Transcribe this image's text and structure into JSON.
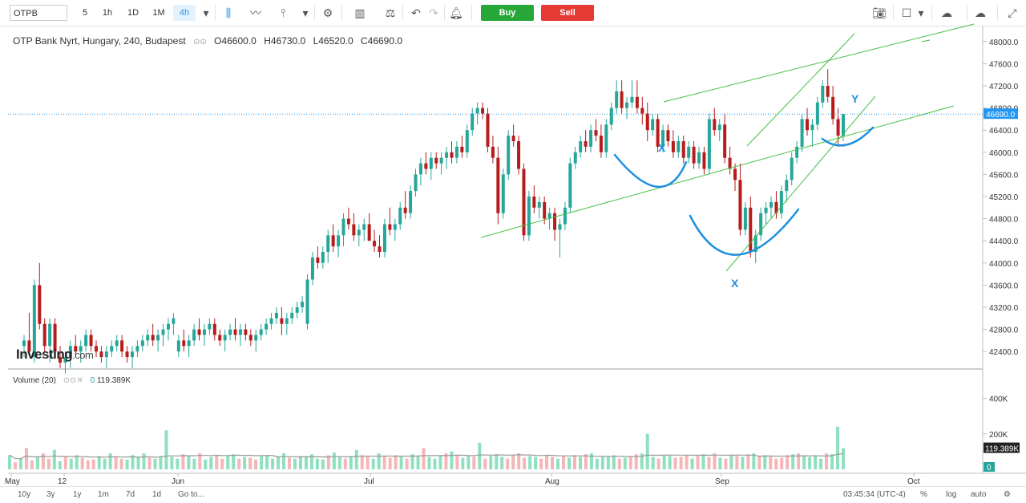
{
  "toolbar": {
    "symbol": "OTPB",
    "intervals": [
      "5",
      "1h",
      "1D",
      "1M",
      "4h"
    ],
    "active_interval": "4h",
    "buy_label": "Buy",
    "sell_label": "Sell"
  },
  "legend": {
    "title": "OTP Bank Nyrt, Hungary, 240, Budapest",
    "open": "O46600.0",
    "high": "H46730.0",
    "low": "L46520.0",
    "close": "C46690.0"
  },
  "volume_legend": {
    "label": "Volume (20)",
    "value_prefix": "0",
    "value": "119.389K"
  },
  "logo": {
    "main": "Investing",
    "suffix": ".com"
  },
  "bottom": {
    "ranges": [
      "10y",
      "3y",
      "1y",
      "1m",
      "7d",
      "1d"
    ],
    "goto": "Go to...",
    "clock": "03:45:34 (UTC-4)",
    "percent": "%",
    "log": "log",
    "auto": "auto"
  },
  "colors": {
    "up": "#26a69a",
    "down": "#b71c1c",
    "vol_up": "#8fe0c0",
    "vol_down": "#f4b6b6",
    "trend": "#43c043",
    "pattern": "#1e90e0",
    "last_price": "#2196f3"
  },
  "chart_data": {
    "type": "candlestick",
    "title": "OTP Bank Nyrt, Hungary, 240, Budapest",
    "price_axis": {
      "ylim": [
        42200,
        48200
      ],
      "ticks": [
        42400,
        42800,
        43200,
        43600,
        44000,
        44400,
        44800,
        45200,
        45600,
        46000,
        46400,
        46800,
        47200,
        47600,
        48000
      ]
    },
    "volume_axis": {
      "ylim": [
        0,
        520000
      ],
      "ticks": [
        "400K",
        "200K"
      ]
    },
    "x_labels": [
      "May",
      "12",
      "Jun",
      "Jul",
      "Aug",
      "Sep",
      "Oct"
    ],
    "last_price": 46690.0,
    "last_volume": "119.389K",
    "candles_ohlc": [
      [
        42500,
        42700,
        42300,
        42600
      ],
      [
        42600,
        43100,
        42400,
        42400
      ],
      [
        42300,
        43700,
        42200,
        43600
      ],
      [
        43600,
        44000,
        42800,
        42900
      ],
      [
        42900,
        43000,
        42400,
        42500
      ],
      [
        42500,
        43000,
        42200,
        42900
      ],
      [
        42900,
        43000,
        42300,
        42400
      ],
      [
        42300,
        42500,
        42100,
        42200
      ],
      [
        42200,
        42400,
        42000,
        42300
      ],
      [
        42300,
        42600,
        42100,
        42500
      ],
      [
        42500,
        42700,
        42300,
        42400
      ],
      [
        42400,
        42600,
        42200,
        42500
      ],
      [
        42500,
        42800,
        42400,
        42700
      ],
      [
        42700,
        42800,
        42400,
        42500
      ],
      [
        42500,
        42600,
        42300,
        42400
      ],
      [
        42400,
        42500,
        42200,
        42300
      ],
      [
        42300,
        42500,
        42100,
        42400
      ],
      [
        42400,
        42600,
        42300,
        42500
      ],
      [
        42500,
        42700,
        42400,
        42600
      ],
      [
        42600,
        42700,
        42300,
        42400
      ],
      [
        42400,
        42500,
        42200,
        42300
      ],
      [
        42300,
        42500,
        42100,
        42400
      ],
      [
        42400,
        42600,
        42300,
        42500
      ],
      [
        42500,
        42700,
        42400,
        42600
      ],
      [
        42600,
        42800,
        42500,
        42700
      ],
      [
        42700,
        42900,
        42500,
        42600
      ],
      [
        42600,
        42800,
        42400,
        42700
      ],
      [
        42700,
        42900,
        42500,
        42800
      ],
      [
        42800,
        43000,
        42600,
        42900
      ],
      [
        42900,
        43100,
        42700,
        43000
      ],
      [
        42400,
        42700,
        42300,
        42600
      ],
      [
        42600,
        42800,
        42400,
        42500
      ],
      [
        42500,
        42700,
        42300,
        42600
      ],
      [
        42600,
        42900,
        42500,
        42800
      ],
      [
        42800,
        43000,
        42600,
        42700
      ],
      [
        42700,
        42900,
        42500,
        42800
      ],
      [
        42800,
        43000,
        42700,
        42900
      ],
      [
        42900,
        43000,
        42600,
        42700
      ],
      [
        42700,
        42800,
        42500,
        42600
      ],
      [
        42600,
        42800,
        42400,
        42700
      ],
      [
        42700,
        42900,
        42600,
        42800
      ],
      [
        42800,
        43000,
        42600,
        42700
      ],
      [
        42700,
        42900,
        42500,
        42800
      ],
      [
        42800,
        42900,
        42600,
        42700
      ],
      [
        42700,
        42800,
        42500,
        42600
      ],
      [
        42600,
        42800,
        42400,
        42700
      ],
      [
        42700,
        42900,
        42600,
        42800
      ],
      [
        42800,
        43000,
        42700,
        42900
      ],
      [
        42900,
        43100,
        42800,
        43000
      ],
      [
        43000,
        43200,
        42900,
        43100
      ],
      [
        43000,
        43200,
        42700,
        42900
      ],
      [
        42900,
        43100,
        42700,
        43000
      ],
      [
        43000,
        43200,
        42900,
        43100
      ],
      [
        43100,
        43300,
        43000,
        43200
      ],
      [
        43200,
        43400,
        43100,
        43300
      ],
      [
        42900,
        43800,
        42800,
        43700
      ],
      [
        43700,
        44200,
        43600,
        44100
      ],
      [
        44100,
        44300,
        43900,
        44000
      ],
      [
        44000,
        44300,
        43900,
        44200
      ],
      [
        44200,
        44600,
        44000,
        44500
      ],
      [
        44500,
        44700,
        44200,
        44300
      ],
      [
        44300,
        44600,
        44100,
        44500
      ],
      [
        44500,
        44900,
        44300,
        44800
      ],
      [
        44800,
        45000,
        44600,
        44700
      ],
      [
        44700,
        44900,
        44400,
        44500
      ],
      [
        44500,
        44700,
        44300,
        44600
      ],
      [
        44600,
        44800,
        44400,
        44700
      ],
      [
        44700,
        44900,
        44500,
        44400
      ],
      [
        44400,
        44600,
        44200,
        44300
      ],
      [
        44300,
        44500,
        44100,
        44200
      ],
      [
        44200,
        44800,
        44100,
        44700
      ],
      [
        44700,
        45000,
        44500,
        44600
      ],
      [
        44600,
        44800,
        44400,
        44700
      ],
      [
        44700,
        45100,
        44600,
        45000
      ],
      [
        45000,
        45300,
        44800,
        44900
      ],
      [
        44900,
        45400,
        44800,
        45300
      ],
      [
        45300,
        45700,
        45200,
        45600
      ],
      [
        45600,
        45900,
        45400,
        45800
      ],
      [
        45800,
        46000,
        45600,
        45700
      ],
      [
        45700,
        46000,
        45500,
        45900
      ],
      [
        45900,
        46000,
        45700,
        45800
      ],
      [
        45800,
        46000,
        45600,
        45900
      ],
      [
        45900,
        46100,
        45700,
        46000
      ],
      [
        46000,
        46200,
        45800,
        45900
      ],
      [
        45900,
        46200,
        45800,
        46100
      ],
      [
        46100,
        46300,
        45900,
        46000
      ],
      [
        46000,
        46500,
        45900,
        46400
      ],
      [
        46400,
        46800,
        46300,
        46700
      ],
      [
        46700,
        46900,
        46500,
        46800
      ],
      [
        46800,
        46900,
        46600,
        46700
      ],
      [
        46700,
        46800,
        46000,
        46100
      ],
      [
        46100,
        46300,
        45800,
        45900
      ],
      [
        45900,
        46100,
        44700,
        44900
      ],
      [
        44900,
        45700,
        44800,
        45600
      ],
      [
        45600,
        46400,
        45500,
        46300
      ],
      [
        46300,
        46500,
        46100,
        46200
      ],
      [
        46200,
        46300,
        45600,
        45700
      ],
      [
        45700,
        45800,
        44400,
        44500
      ],
      [
        44500,
        45300,
        44400,
        45200
      ],
      [
        45200,
        45400,
        44900,
        45000
      ],
      [
        45000,
        45200,
        44800,
        45100
      ],
      [
        45100,
        45200,
        44700,
        44800
      ],
      [
        44800,
        45000,
        44600,
        44900
      ],
      [
        44900,
        45000,
        44400,
        44600
      ],
      [
        44600,
        44800,
        44100,
        44700
      ],
      [
        44700,
        45100,
        44600,
        45000
      ],
      [
        45000,
        45900,
        44900,
        45800
      ],
      [
        45800,
        46100,
        45700,
        46000
      ],
      [
        46000,
        46300,
        45900,
        46200
      ],
      [
        46200,
        46400,
        46000,
        46100
      ],
      [
        46100,
        46500,
        46000,
        46400
      ],
      [
        46400,
        46600,
        46200,
        46300
      ],
      [
        46300,
        46500,
        45900,
        46000
      ],
      [
        46000,
        46600,
        45900,
        46500
      ],
      [
        46500,
        46900,
        46400,
        46800
      ],
      [
        46800,
        47300,
        46700,
        47100
      ],
      [
        47100,
        47300,
        46700,
        46800
      ],
      [
        46800,
        47000,
        46600,
        46900
      ],
      [
        46900,
        47300,
        46800,
        47000
      ],
      [
        47000,
        47300,
        46700,
        46800
      ],
      [
        46800,
        47000,
        46500,
        46700
      ],
      [
        46700,
        46900,
        46200,
        46400
      ],
      [
        46400,
        46700,
        46300,
        46600
      ],
      [
        46600,
        46700,
        46000,
        46100
      ],
      [
        46100,
        46500,
        46000,
        46400
      ],
      [
        46400,
        46500,
        46100,
        46200
      ],
      [
        46200,
        46400,
        45900,
        46000
      ],
      [
        46000,
        46300,
        45900,
        46200
      ],
      [
        46200,
        46300,
        45800,
        45900
      ],
      [
        45900,
        46200,
        45800,
        46100
      ],
      [
        46100,
        46200,
        45700,
        45800
      ],
      [
        45800,
        46100,
        45700,
        46000
      ],
      [
        46000,
        46100,
        45600,
        45700
      ],
      [
        45700,
        46700,
        45600,
        46600
      ],
      [
        46600,
        46800,
        46300,
        46400
      ],
      [
        46400,
        46600,
        46200,
        46500
      ],
      [
        46500,
        46700,
        45800,
        45900
      ],
      [
        45900,
        46100,
        45600,
        45700
      ],
      [
        45700,
        45800,
        45300,
        45500
      ],
      [
        45500,
        45800,
        44500,
        44600
      ],
      [
        44600,
        45100,
        44500,
        45000
      ],
      [
        45000,
        45200,
        44100,
        44200
      ],
      [
        44200,
        44600,
        44000,
        44500
      ],
      [
        44500,
        45000,
        44400,
        44900
      ],
      [
        44900,
        45100,
        44700,
        45000
      ],
      [
        45000,
        45200,
        44800,
        45100
      ],
      [
        45100,
        45300,
        44800,
        44900
      ],
      [
        44900,
        45400,
        44800,
        45300
      ],
      [
        45300,
        45600,
        45100,
        45500
      ],
      [
        45500,
        46000,
        45400,
        45900
      ],
      [
        45900,
        46200,
        45800,
        46100
      ],
      [
        46100,
        46700,
        46000,
        46600
      ],
      [
        46600,
        46800,
        46300,
        46400
      ],
      [
        46400,
        46600,
        46100,
        46500
      ],
      [
        46500,
        47000,
        46400,
        46900
      ],
      [
        46900,
        47300,
        46800,
        47200
      ],
      [
        47200,
        47500,
        46900,
        47000
      ],
      [
        47000,
        47200,
        46500,
        46600
      ],
      [
        46600,
        46800,
        46100,
        46300
      ],
      [
        46300,
        46700,
        46200,
        46690
      ]
    ],
    "volumes_k": [
      80,
      40,
      60,
      120,
      50,
      70,
      90,
      60,
      110,
      45,
      70,
      60,
      80,
      65,
      50,
      55,
      75,
      60,
      90,
      70,
      60,
      55,
      80,
      70,
      90,
      65,
      60,
      75,
      220,
      70,
      60,
      85,
      75,
      60,
      90,
      55,
      70,
      80,
      60,
      75,
      85,
      60,
      70,
      65,
      55,
      75,
      80,
      60,
      70,
      90,
      65,
      60,
      75,
      70,
      85,
      60,
      55,
      80,
      95,
      70,
      60,
      75,
      110,
      80,
      70,
      60,
      90,
      75,
      65,
      80,
      70,
      60,
      85,
      75,
      120,
      70,
      60,
      80,
      90,
      100,
      75,
      65,
      80,
      70,
      150,
      60,
      75,
      85,
      70,
      60,
      80,
      90,
      65,
      75,
      70,
      60,
      80,
      70,
      60,
      75,
      65,
      80,
      70,
      85,
      90,
      60,
      75,
      70,
      80,
      60,
      65,
      75,
      85,
      90,
      200,
      70,
      60,
      80,
      75,
      65,
      70,
      80,
      60,
      75,
      85,
      70,
      90,
      65,
      60,
      80,
      75,
      70,
      85,
      90,
      75,
      80,
      70,
      60,
      65,
      80,
      85,
      90,
      75,
      70,
      80,
      60,
      90,
      85,
      240,
      119
    ],
    "annotations": [
      "X",
      "X",
      "Y"
    ]
  }
}
